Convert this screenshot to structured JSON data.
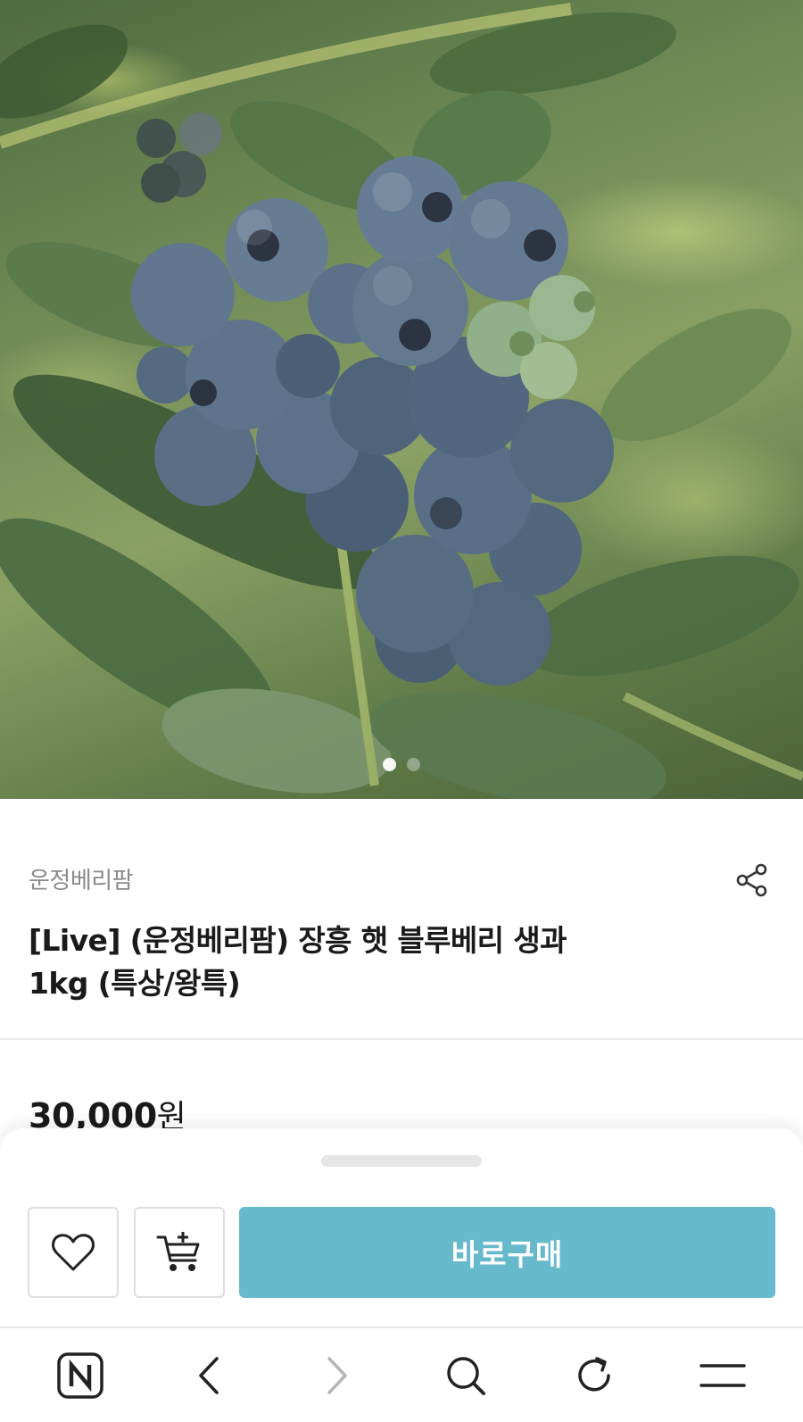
{
  "product_image": {
    "description_icon": "blueberry-photo",
    "carousel": {
      "total": 2,
      "active_index": 0
    }
  },
  "product": {
    "seller": "운정베리팜",
    "title_line1": "[Live] (운정베리팜) 장흥 햇 블루베리 생과",
    "title_line2": "1kg (특상/왕특)",
    "price_number": "30,000",
    "price_unit": "원"
  },
  "icons": {
    "share": "share-icon",
    "wishlist": "heart-icon",
    "cart": "add-to-cart-icon"
  },
  "actions": {
    "buy_label": "바로구매"
  },
  "colors": {
    "buy_button": "#67b9cc",
    "seller_text": "#8a8a8a",
    "title_text": "#1a1a1a"
  },
  "browser_bar": {
    "items": [
      "naver-home-icon",
      "back-icon",
      "forward-icon",
      "search-icon",
      "refresh-icon",
      "menu-icon"
    ],
    "forward_disabled": true
  }
}
